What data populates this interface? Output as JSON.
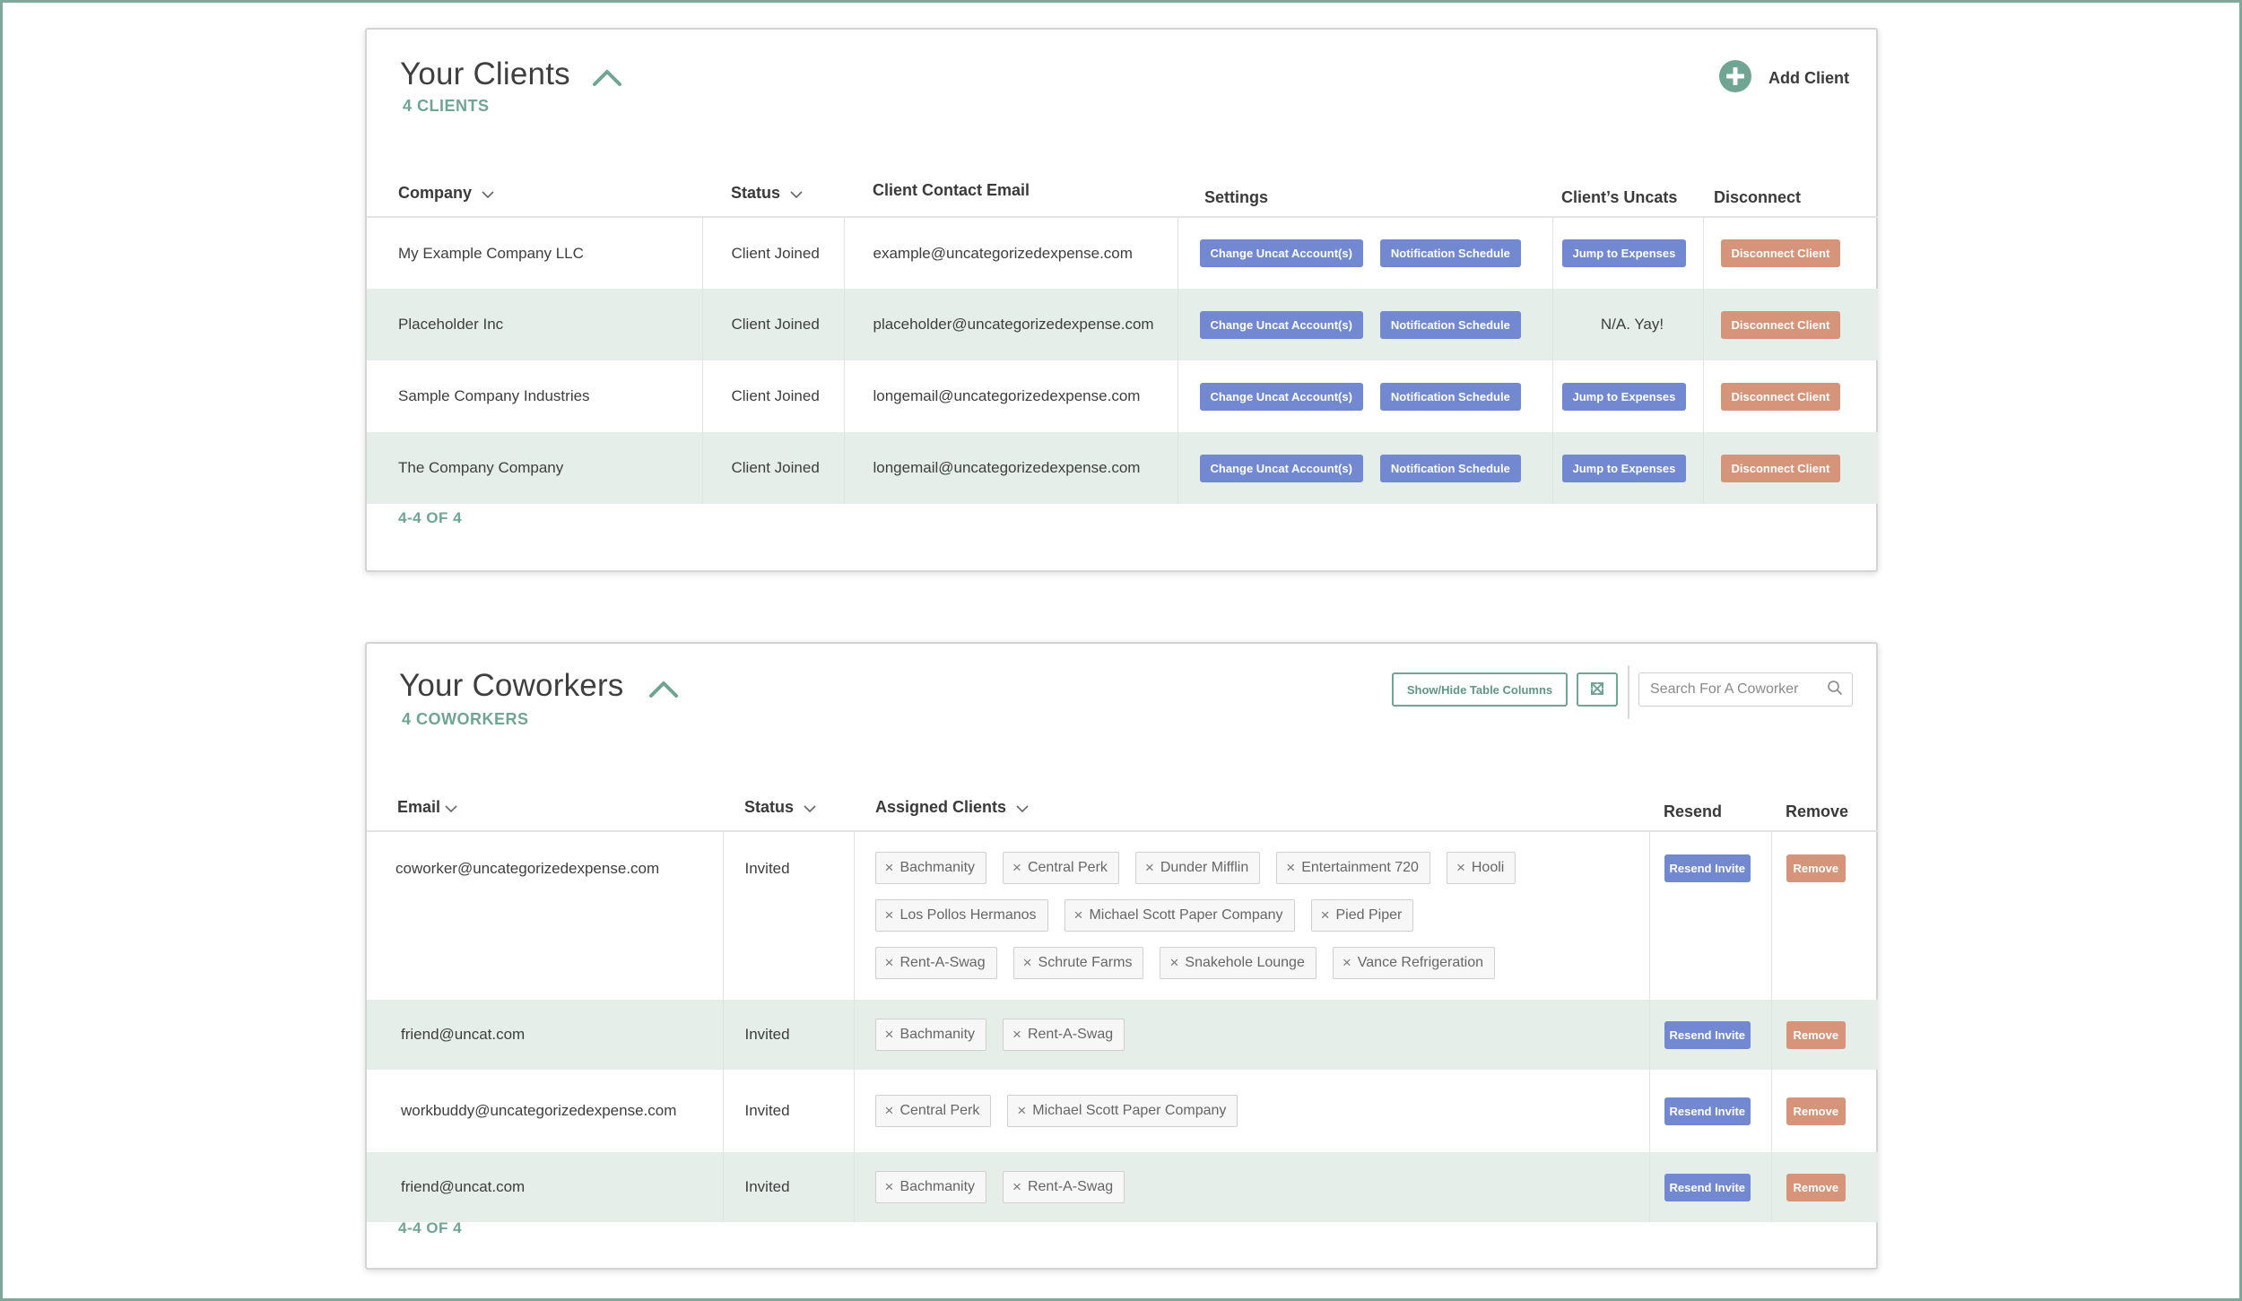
{
  "clients": {
    "title": "Your Clients",
    "count_label": "4 CLIENTS",
    "add_label": "Add Client",
    "columns": {
      "company": "Company",
      "status": "Status",
      "email": "Client Contact Email",
      "settings": "Settings",
      "uncats": "Client’s Uncats",
      "disconnect": "Disconnect"
    },
    "rows": [
      {
        "company": "My Example Company LLC",
        "status": "Client Joined",
        "email": "example@uncategorizedexpense.com",
        "change": "Change Uncat Account(s)",
        "notify": "Notification Schedule",
        "uncats": "Jump to Expenses",
        "uncats_is_button": true,
        "disconnect": "Disconnect Client"
      },
      {
        "company": "Placeholder Inc",
        "status": "Client Joined",
        "email": "placeholder@uncategorizedexpense.com",
        "change": "Change Uncat Account(s)",
        "notify": "Notification Schedule",
        "uncats": "N/A. Yay!",
        "uncats_is_button": false,
        "disconnect": "Disconnect Client"
      },
      {
        "company": "Sample Company Industries",
        "status": "Client Joined",
        "email": "longemail@uncategorizedexpense.com",
        "change": "Change Uncat Account(s)",
        "notify": "Notification Schedule",
        "uncats": "Jump to Expenses",
        "uncats_is_button": true,
        "disconnect": "Disconnect Client"
      },
      {
        "company": "The Company Company",
        "status": "Client Joined",
        "email": "longemail@uncategorizedexpense.com",
        "change": "Change Uncat Account(s)",
        "notify": "Notification Schedule",
        "uncats": "Jump to Expenses",
        "uncats_is_button": true,
        "disconnect": "Disconnect Client"
      }
    ],
    "pager": "4-4 OF 4"
  },
  "coworkers": {
    "title": "Your Coworkers",
    "count_label": "4 COWORKERS",
    "columns_button": "Show/Hide Table Columns",
    "search_placeholder": "Search For A Coworker",
    "columns": {
      "email": "Email",
      "status": "Status",
      "assigned": "Assigned Clients",
      "resend": "Resend",
      "remove": "Remove"
    },
    "rows": [
      {
        "email": "coworker@uncategorizedexpense.com",
        "status": "Invited",
        "tags": [
          "Bachmanity",
          "Central Perk",
          "Dunder Mifflin",
          "Entertainment 720",
          "Hooli",
          "Los Pollos Hermanos",
          "Michael Scott Paper Company",
          "Pied Piper",
          "Rent-A-Swag",
          "Schrute Farms",
          "Snakehole Lounge",
          "Vance Refrigeration"
        ],
        "resend": "Resend Invite",
        "remove": "Remove"
      },
      {
        "email": "friend@uncat.com",
        "status": "Invited",
        "tags": [
          "Bachmanity",
          "Rent-A-Swag"
        ],
        "resend": "Resend Invite",
        "remove": "Remove"
      },
      {
        "email": "workbuddy@uncategorizedexpense.com",
        "status": "Invited",
        "tags": [
          "Central Perk",
          "Michael Scott Paper Company"
        ],
        "resend": "Resend Invite",
        "remove": "Remove"
      },
      {
        "email": "friend@uncat.com",
        "status": "Invited",
        "tags": [
          "Bachmanity",
          "Rent-A-Swag"
        ],
        "resend": "Resend Invite",
        "remove": "Remove"
      }
    ],
    "pager": "4-4 OF 4"
  },
  "theme": {
    "accent_green": "#6fa592",
    "button_blue": "#7289d1",
    "button_orange": "#d6957a",
    "row_alt": "#e6eeea"
  },
  "icons": {
    "collapse": "chevron-up-icon",
    "sort": "chevron-down-icon",
    "add": "plus-circle-icon",
    "remove_tag": "close-icon",
    "expand": "expand-arrows-icon",
    "search": "search-icon"
  }
}
